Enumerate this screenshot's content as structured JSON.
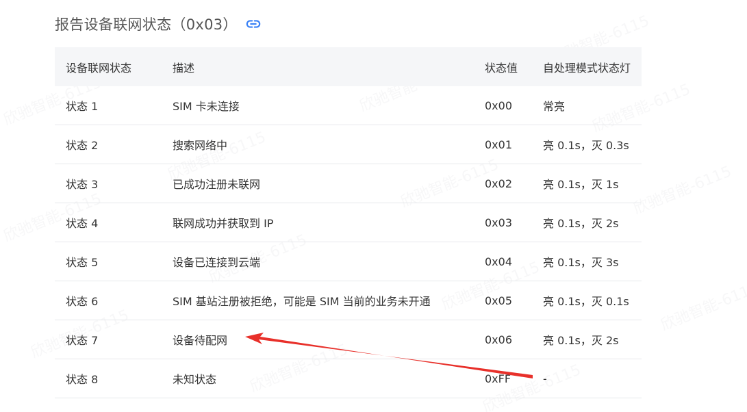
{
  "heading": {
    "title": "报告设备联网状态（0x03）",
    "icon": "link-icon"
  },
  "table": {
    "columns": [
      "设备联网状态",
      "描述",
      "状态值",
      "自处理模式状态灯"
    ],
    "rows": [
      [
        "状态 1",
        "SIM 卡未连接",
        "0x00",
        "常亮"
      ],
      [
        "状态 2",
        "搜索网络中",
        "0x01",
        "亮 0.1s，灭 0.3s"
      ],
      [
        "状态 3",
        "已成功注册未联网",
        "0x02",
        "亮 0.1s，灭 1s"
      ],
      [
        "状态 4",
        "联网成功并获取到 IP",
        "0x03",
        "亮 0.1s，灭 2s"
      ],
      [
        "状态 5",
        "设备已连接到云端",
        "0x04",
        "亮 0.1s，灭 3s"
      ],
      [
        "状态 6",
        "SIM 基站注册被拒绝，可能是 SIM 当前的业务未开通",
        "0x05",
        "亮 0.1s，灭 0.1s"
      ],
      [
        "状态 7",
        "设备待配网",
        "0x06",
        "亮 0.1s，灭 2s"
      ],
      [
        "状态 8",
        "未知状态",
        "0xFF",
        "-"
      ]
    ]
  },
  "annotation": {
    "arrow_color": "#e8302a"
  }
}
